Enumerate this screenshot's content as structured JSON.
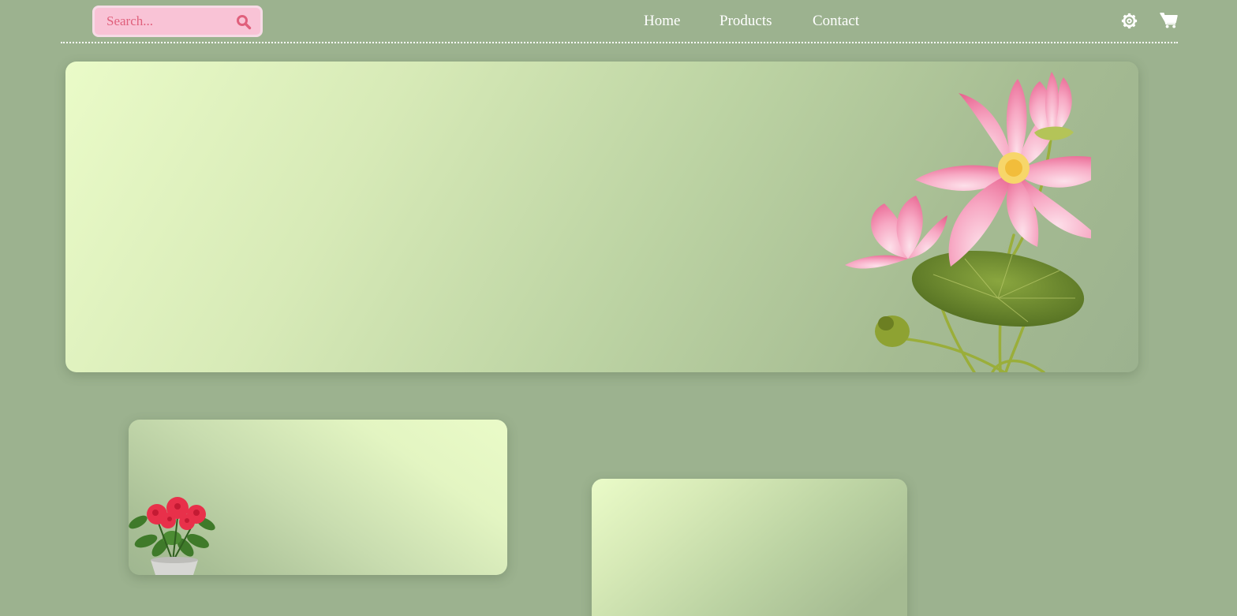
{
  "header": {
    "search": {
      "placeholder": "Search...",
      "value": "",
      "icon": "search-icon"
    },
    "nav": {
      "items": [
        {
          "label": "Home"
        },
        {
          "label": "Products"
        },
        {
          "label": "Contact"
        }
      ]
    },
    "actions": {
      "settings_icon": "gear-icon",
      "cart_icon": "cart-icon"
    }
  },
  "hero": {
    "image": "lotus-illustration"
  },
  "cards": [
    {
      "image": "potted-plant"
    },
    {
      "image": ""
    }
  ],
  "colors": {
    "page_background": "#9cb28f",
    "search_background": "#f9c3d6",
    "search_border": "#f7dbe6",
    "search_accent": "#e0607c",
    "nav_text": "#ffffff",
    "gradient_light": "#eafbc8",
    "gradient_dark": "#9cb28f"
  }
}
